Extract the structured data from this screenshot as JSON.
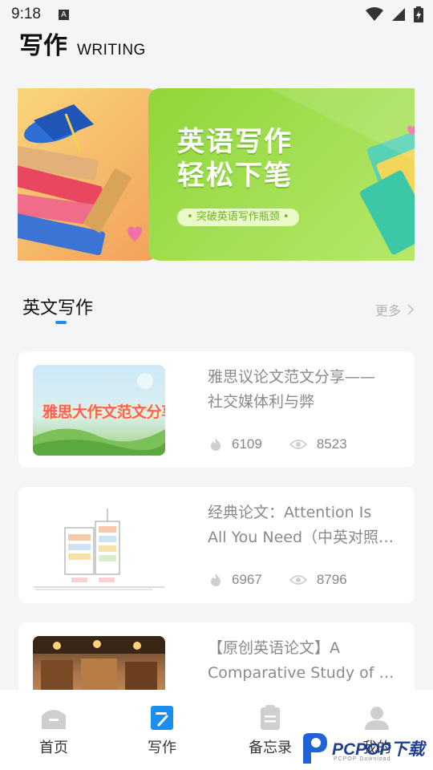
{
  "status_bar": {
    "time": "9:18",
    "notification_letter": "A"
  },
  "header": {
    "title": "写作",
    "subtitle": "WRITING"
  },
  "banner": {
    "headline_line1": "英语写作",
    "headline_line2": "轻松下笔",
    "tagline": "• 突破英语写作瓶颈 •"
  },
  "section": {
    "title": "英文写作",
    "more_label": "更多"
  },
  "articles": [
    {
      "title_line1": "雅思议论文范文分享——",
      "title_line2": "社交媒体利与弊",
      "thumb_text": "雅思大作文范文分享",
      "likes": "6109",
      "views": "8523"
    },
    {
      "title_line1": "经典论文：Attention Is",
      "title_line2": "All You Need（中英对照…",
      "likes": "6967",
      "views": "8796"
    },
    {
      "title_line1": "【原创英语论文】A",
      "title_line2": "Comparative Study of C…"
    }
  ],
  "tabbar": {
    "home": "首页",
    "write": "写作",
    "memo": "备忘录",
    "me": "我的"
  },
  "colors": {
    "accent": "#1a8ff0",
    "banner_green": "#8fd63a",
    "card_bg": "#ffffff",
    "page_bg": "#f4f5f7"
  },
  "watermark": {
    "text": "PCPOP下载",
    "sub": "PCPOP Download"
  }
}
